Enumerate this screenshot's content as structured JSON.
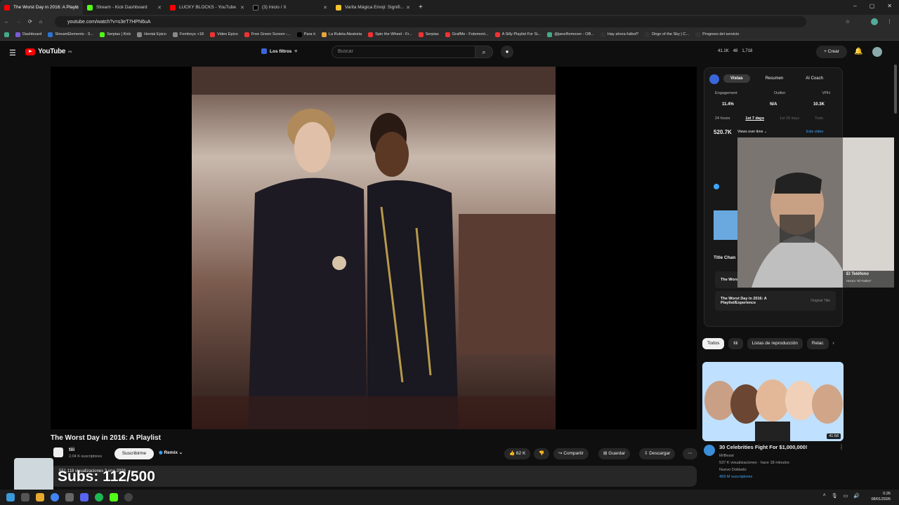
{
  "browser": {
    "tabs": [
      {
        "title": "The Worst Day in 2016: A Playlist",
        "color": "#ff0000",
        "active": true
      },
      {
        "title": "Stream - Kick Dashboard",
        "color": "#53fc18"
      },
      {
        "title": "LUCKY BLOCKS - YouTube",
        "color": "#ff0000"
      },
      {
        "title": "(3) Inicio / X",
        "color": "#000000"
      },
      {
        "title": "Varita Mágica Emoji: Signifi...",
        "color": "#f4c430"
      }
    ],
    "new_tab": "+",
    "url": "youtube.com/watch?v=s3eT7HPN6uA",
    "bookmarks": [
      "Dashboard",
      "StreamElements - S...",
      "Serpias | Kick",
      "Hentai Epico",
      "Femboys +18",
      "Video Epico",
      "Free Green Screen -...",
      "Para ti",
      "La Ruleta Aleatoria",
      "Spin the Wheel - Fr...",
      "Serpias",
      "GrafMe - Fotomont...",
      "A Silly Playlist For Si...",
      "@janeRemover - OB...",
      "Hay ahora futbol?",
      "Dirge of the Sky | C...",
      "Progreso del servicio"
    ],
    "window_controls": [
      "–",
      "▢",
      "✕"
    ]
  },
  "youtube": {
    "logo_text": "YouTube",
    "logo_sup": "ES",
    "filters_label": "Los filtros",
    "search_placeholder": "Buscar",
    "header_stats": [
      "41.1K",
      "48",
      "1,718"
    ],
    "create_label": "Crear"
  },
  "video": {
    "title": "The Worst Day in 2016: A Playlist",
    "channel": "tiii",
    "subscribers": "2,04 K suscriptores",
    "subscribe_label": "Suscribirme",
    "remix_label": "Remix",
    "likes": "62 K",
    "share_label": "Compartir",
    "save_label": "Guardar",
    "download_label": "Descargar",
    "desc_line": "551.118 visualizaciones  3 ene 2026"
  },
  "overlay": {
    "subs_text": "Subs: 112/500",
    "caller": "El Teléfono",
    "caller_sub": "Hector \"El Father\""
  },
  "analytics": {
    "tabs": [
      "Vistas",
      "Resumen",
      "AI Coach"
    ],
    "metric_labels": [
      "Engagement",
      "Outlier",
      "VPH"
    ],
    "metric_values": [
      "11.4%",
      "N/A",
      "10.3K"
    ],
    "ranges": [
      "24 hours",
      "1st 7 days",
      "1st 28 days",
      "Todo"
    ],
    "views": "520.7K",
    "views_over_time": "Views over time",
    "este_video": "Este video",
    "title_changes": "Title Chan",
    "title_rows": [
      {
        "title": "The Worst",
        "tag": ""
      },
      {
        "title": "The Worst Day in 2016: A Playlist/Experience",
        "tag": "Original Title"
      }
    ]
  },
  "chips": [
    "Todos",
    "tiii",
    "Listas de reproducción",
    "Relac"
  ],
  "recommended": {
    "title": "30 Celebrities Fight For $1,000,000!",
    "channel": "MrBeast",
    "meta": "537 K visualizaciones · hace 18 minutos",
    "badges": "Nuevo  Doblado",
    "subs": "469 M suscriptores",
    "duration": "41:58"
  },
  "taskbar": {
    "time": "0:26",
    "date": "08/01/2026"
  }
}
